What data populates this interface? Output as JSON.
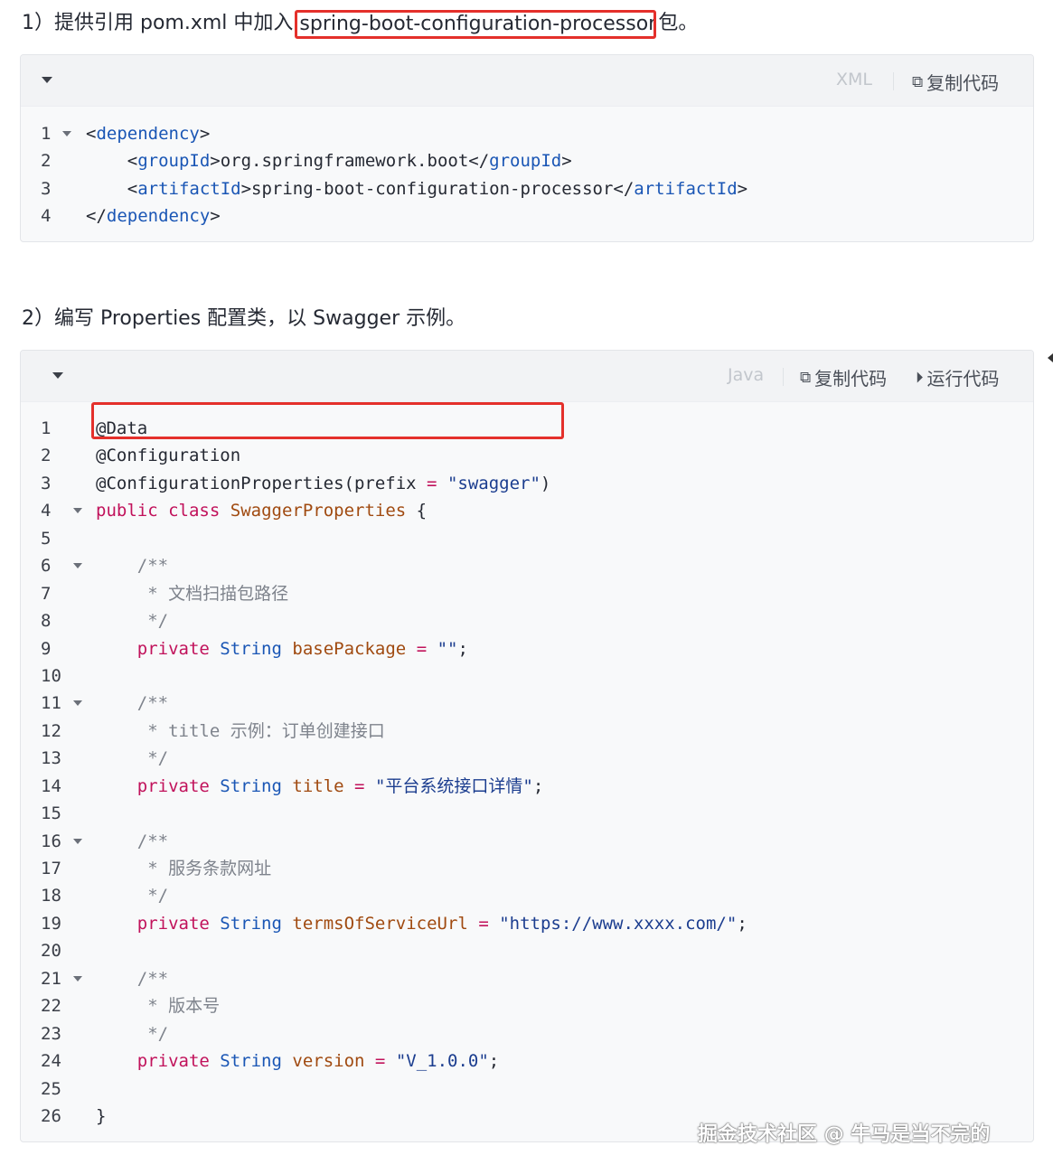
{
  "step1": {
    "prefix": "1）提供引用 pom.xml 中加入",
    "highlight": "spring-boot-configuration-processor",
    "suffix": "包。"
  },
  "step2": {
    "text": "2）编写 Properties 配置类，以 Swagger 示例。"
  },
  "block1": {
    "lang": "XML",
    "copy_label": "复制代码",
    "lines": [
      {
        "num": "1",
        "fold": true,
        "tokens": [
          [
            "p",
            "<"
          ],
          [
            "tn",
            "dependency"
          ],
          [
            "p",
            ">"
          ]
        ]
      },
      {
        "num": "2",
        "fold": false,
        "tokens": [
          [
            "p",
            "    <"
          ],
          [
            "tn",
            "groupId"
          ],
          [
            "p",
            ">org.springframework.boot</"
          ],
          [
            "tn",
            "groupId"
          ],
          [
            "p",
            ">"
          ]
        ]
      },
      {
        "num": "3",
        "fold": false,
        "tokens": [
          [
            "p",
            "    <"
          ],
          [
            "tn",
            "artifactId"
          ],
          [
            "p",
            ">spring-boot-configuration-processor</"
          ],
          [
            "tn",
            "artifactId"
          ],
          [
            "p",
            ">"
          ]
        ]
      },
      {
        "num": "4",
        "fold": false,
        "tokens": [
          [
            "p",
            "</"
          ],
          [
            "tn",
            "dependency"
          ],
          [
            "p",
            ">"
          ]
        ]
      }
    ]
  },
  "block2": {
    "lang": "Java",
    "copy_label": "复制代码",
    "run_label": "运行代码",
    "lines": [
      {
        "num": "1",
        "fold": false,
        "tokens": [
          [
            "p",
            "@Data"
          ]
        ]
      },
      {
        "num": "2",
        "fold": false,
        "tokens": [
          [
            "p",
            "@Configuration"
          ]
        ]
      },
      {
        "num": "3",
        "fold": false,
        "tokens": [
          [
            "p",
            "@ConfigurationProperties(prefix "
          ],
          [
            "op",
            "="
          ],
          [
            "p",
            " "
          ],
          [
            "st",
            "\"swagger\""
          ],
          [
            "p",
            ")"
          ]
        ]
      },
      {
        "num": "4",
        "fold": true,
        "tokens": [
          [
            "kw",
            "public"
          ],
          [
            "p",
            " "
          ],
          [
            "kw",
            "class"
          ],
          [
            "p",
            " "
          ],
          [
            "vr",
            "SwaggerProperties"
          ],
          [
            "p",
            " {"
          ]
        ]
      },
      {
        "num": "5",
        "fold": false,
        "tokens": []
      },
      {
        "num": "6",
        "fold": true,
        "tokens": [
          [
            "cm",
            "    /**"
          ]
        ]
      },
      {
        "num": "7",
        "fold": false,
        "tokens": [
          [
            "cm",
            "     * 文档扫描包路径"
          ]
        ]
      },
      {
        "num": "8",
        "fold": false,
        "tokens": [
          [
            "cm",
            "     */"
          ]
        ]
      },
      {
        "num": "9",
        "fold": false,
        "tokens": [
          [
            "kw",
            "    private"
          ],
          [
            "p",
            " "
          ],
          [
            "ty",
            "String"
          ],
          [
            "p",
            " "
          ],
          [
            "vr",
            "basePackage"
          ],
          [
            "p",
            " "
          ],
          [
            "op",
            "="
          ],
          [
            "p",
            " "
          ],
          [
            "st",
            "\"\""
          ],
          [
            "p",
            ";"
          ]
        ]
      },
      {
        "num": "10",
        "fold": false,
        "tokens": []
      },
      {
        "num": "11",
        "fold": true,
        "tokens": [
          [
            "cm",
            "    /**"
          ]
        ]
      },
      {
        "num": "12",
        "fold": false,
        "tokens": [
          [
            "cm",
            "     * title 示例：订单创建接口"
          ]
        ]
      },
      {
        "num": "13",
        "fold": false,
        "tokens": [
          [
            "cm",
            "     */"
          ]
        ]
      },
      {
        "num": "14",
        "fold": false,
        "tokens": [
          [
            "kw",
            "    private"
          ],
          [
            "p",
            " "
          ],
          [
            "ty",
            "String"
          ],
          [
            "p",
            " "
          ],
          [
            "vr",
            "title"
          ],
          [
            "p",
            " "
          ],
          [
            "op",
            "="
          ],
          [
            "p",
            " "
          ],
          [
            "st",
            "\"平台系统接口详情\""
          ],
          [
            "p",
            ";"
          ]
        ]
      },
      {
        "num": "15",
        "fold": false,
        "tokens": []
      },
      {
        "num": "16",
        "fold": true,
        "tokens": [
          [
            "cm",
            "    /**"
          ]
        ]
      },
      {
        "num": "17",
        "fold": false,
        "tokens": [
          [
            "cm",
            "     * 服务条款网址"
          ]
        ]
      },
      {
        "num": "18",
        "fold": false,
        "tokens": [
          [
            "cm",
            "     */"
          ]
        ]
      },
      {
        "num": "19",
        "fold": false,
        "tokens": [
          [
            "kw",
            "    private"
          ],
          [
            "p",
            " "
          ],
          [
            "ty",
            "String"
          ],
          [
            "p",
            " "
          ],
          [
            "vr",
            "termsOfServiceUrl"
          ],
          [
            "p",
            " "
          ],
          [
            "op",
            "="
          ],
          [
            "p",
            " "
          ],
          [
            "st",
            "\"https://www.xxxx.com/\""
          ],
          [
            "p",
            ";"
          ]
        ]
      },
      {
        "num": "20",
        "fold": false,
        "tokens": []
      },
      {
        "num": "21",
        "fold": true,
        "tokens": [
          [
            "cm",
            "    /**"
          ]
        ]
      },
      {
        "num": "22",
        "fold": false,
        "tokens": [
          [
            "cm",
            "     * 版本号"
          ]
        ]
      },
      {
        "num": "23",
        "fold": false,
        "tokens": [
          [
            "cm",
            "     */"
          ]
        ]
      },
      {
        "num": "24",
        "fold": false,
        "tokens": [
          [
            "kw",
            "    private"
          ],
          [
            "p",
            " "
          ],
          [
            "ty",
            "String"
          ],
          [
            "p",
            " "
          ],
          [
            "vr",
            "version"
          ],
          [
            "p",
            " "
          ],
          [
            "op",
            "="
          ],
          [
            "p",
            " "
          ],
          [
            "st",
            "\"V_1.0.0\""
          ],
          [
            "p",
            ";"
          ]
        ]
      },
      {
        "num": "25",
        "fold": false,
        "tokens": []
      },
      {
        "num": "26",
        "fold": false,
        "tokens": [
          [
            "p",
            "}"
          ]
        ]
      }
    ]
  },
  "watermark": "掘金技术社区 @ 牛马是当不完的",
  "colors": {
    "highlight_border": "#e4302b",
    "tag": "#1a56b5",
    "keyword": "#c1125b",
    "string": "#1b3d8f"
  }
}
